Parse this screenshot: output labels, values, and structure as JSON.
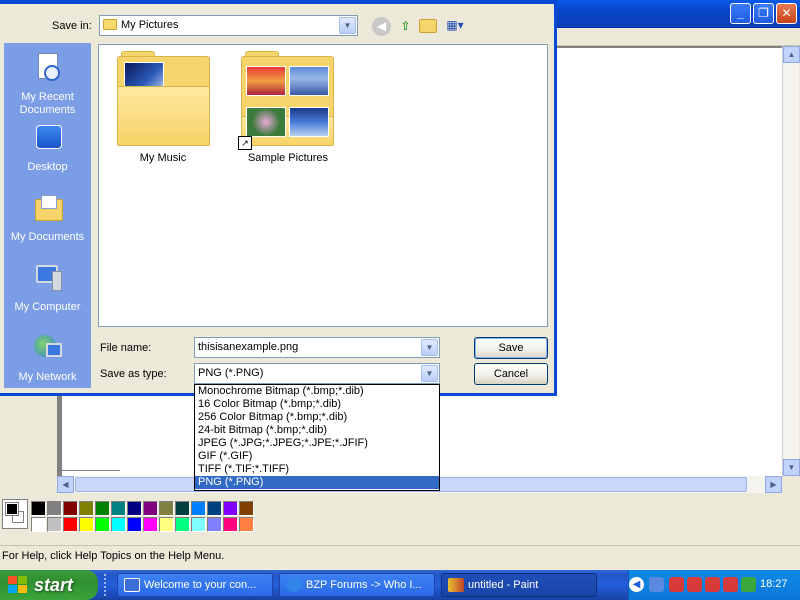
{
  "paint_window": {
    "minimize_glyph": "_",
    "maximize_glyph": "❐",
    "close_glyph": "✕",
    "status_text": "For Help, click Help Topics on the Help Menu.",
    "palette_colors": [
      "#000000",
      "#808080",
      "#800000",
      "#808000",
      "#008000",
      "#008080",
      "#000080",
      "#800080",
      "#808040",
      "#004040",
      "#0080ff",
      "#004080",
      "#8000ff",
      "#804000",
      "#ffffff",
      "#c0c0c0",
      "#ff0000",
      "#ffff00",
      "#00ff00",
      "#00ffff",
      "#0000ff",
      "#ff00ff",
      "#ffff80",
      "#00ff80",
      "#80ffff",
      "#8080ff",
      "#ff0080",
      "#ff8040"
    ]
  },
  "dialog": {
    "save_in_label": "Save in:",
    "save_in_value": "My Pictures",
    "places": [
      {
        "label": "My Recent Documents",
        "icon": "recent-documents-icon"
      },
      {
        "label": "Desktop",
        "icon": "desktop-icon"
      },
      {
        "label": "My Documents",
        "icon": "my-documents-icon"
      },
      {
        "label": "My Computer",
        "icon": "my-computer-icon"
      },
      {
        "label": "My Network",
        "icon": "my-network-icon"
      }
    ],
    "files": [
      {
        "name": "My Music"
      },
      {
        "name": "Sample Pictures"
      }
    ],
    "file_name_label": "File name:",
    "file_name_value": "thisisanexample.png",
    "save_as_type_label": "Save as type:",
    "save_as_type_value": "PNG (*.PNG)",
    "save_button": "Save",
    "cancel_button": "Cancel",
    "type_options": [
      "Monochrome Bitmap (*.bmp;*.dib)",
      "16 Color Bitmap (*.bmp;*.dib)",
      "256 Color Bitmap (*.bmp;*.dib)",
      "24-bit Bitmap (*.bmp;*.dib)",
      "JPEG (*.JPG;*.JPEG;*.JPE;*.JFIF)",
      "GIF (*.GIF)",
      "TIFF (*.TIF;*.TIFF)",
      "PNG (*.PNG)"
    ],
    "selected_type_index": 7
  },
  "taskbar": {
    "start_label": "start",
    "tasks": [
      {
        "label": "Welcome to your con...",
        "active": false,
        "icon_color": "#3a6fd8"
      },
      {
        "label": "BZP Forums -> Who I...",
        "active": false,
        "icon_color": "#2f86e8"
      },
      {
        "label": "untitled - Paint",
        "active": true,
        "icon_color": "#c0462a"
      }
    ],
    "clock": "18:27"
  }
}
